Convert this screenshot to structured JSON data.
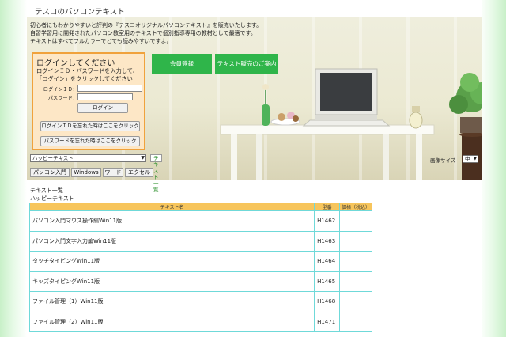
{
  "header": {
    "title": "テスコのパソコンテキスト"
  },
  "hero": {
    "intro": [
      "初心者にもわかりやすいと評判の『テスコオリジナルパソコンテキスト』を販売いたします。",
      "自習学習用に開発されたパソコン教室用のテキストで個別指導専用の教材として最適です。",
      "テキストはすべてフルカラーでとても読みやすいですよ。"
    ],
    "member_button": "会員登録",
    "sales_button": "テキスト販売のご案内"
  },
  "login": {
    "title": "ログインしてください",
    "desc_line1": "ログインＩＤ・パスワードを入力して、",
    "desc_line2": "「ログイン」をクリックしてください",
    "id_label": "ログインＩＤ：",
    "password_label": "パスワード：",
    "id_value": "",
    "password_value": "",
    "login_button": "ログイン",
    "forgot_id_button": "ログインＩＤを忘れた時はここをクリック",
    "forgot_password_button": "パスワードを忘れた時はここをクリック"
  },
  "selector": {
    "selected": "ハッピーテキスト",
    "text_list_button": "テキスト一覧",
    "image_size_label": "画像サイズ",
    "image_size_value": "中"
  },
  "categories": [
    "パソコン入門",
    "Windows",
    "ワード",
    "エクセル"
  ],
  "section": {
    "title": "テキスト一覧",
    "subtitle": "ハッピーテキスト"
  },
  "table": {
    "headers": [
      "テキスト名",
      "型番",
      "価格（税込）"
    ],
    "rows": [
      {
        "name": "パソコン入門マウス操作編Win11版",
        "model": "H1462",
        "price": ""
      },
      {
        "name": "パソコン入門文字入力編Win11版",
        "model": "H1463",
        "price": ""
      },
      {
        "name": "タッチタイピングWin11版",
        "model": "H1464",
        "price": ""
      },
      {
        "name": "キッズタイピングWin11版",
        "model": "H1465",
        "price": ""
      },
      {
        "name": "ファイル管理（1）Win11版",
        "model": "H1468",
        "price": ""
      },
      {
        "name": "ファイル管理（2）Win11版",
        "model": "H1471",
        "price": ""
      }
    ]
  },
  "colors": {
    "login_bg": "#fde7c6",
    "login_border": "#f0a23c",
    "green_button": "#2fb54a",
    "table_header": "#f7c55c",
    "table_border": "#6fd9d9"
  }
}
